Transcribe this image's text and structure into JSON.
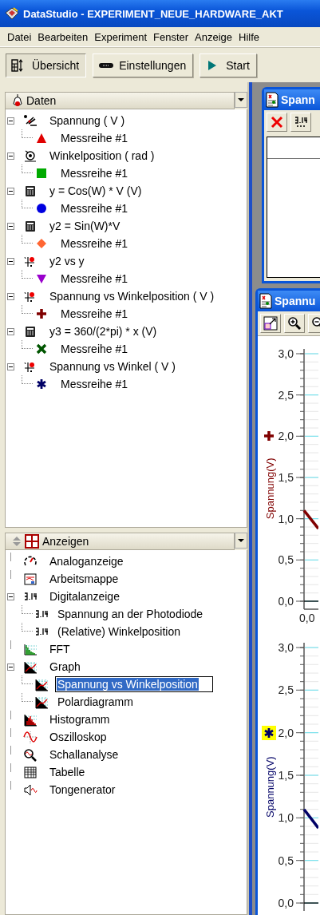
{
  "window": {
    "title": "DataStudio - EXPERIMENT_NEUE_HARDWARE_AKT"
  },
  "menu": [
    "Datei",
    "Bearbeiten",
    "Experiment",
    "Fenster",
    "Anzeige",
    "Hilfe"
  ],
  "toolbar": [
    {
      "label": "Übersicht",
      "kind": "overview",
      "pressed": true
    },
    {
      "label": "Einstellungen",
      "kind": "interface",
      "pressed": false
    },
    {
      "label": "Start",
      "kind": "play",
      "pressed": false
    }
  ],
  "data_panel": {
    "title": "Daten",
    "items": [
      {
        "label": "Spannung ( V )",
        "kind": "sensor",
        "expanded": true,
        "children": [
          {
            "label": "Messreihe #1",
            "kind": "triangle",
            "color": "#e00000"
          }
        ]
      },
      {
        "label": "Winkelposition ( rad )",
        "kind": "rotary",
        "expanded": true,
        "children": [
          {
            "label": "Messreihe #1",
            "kind": "square",
            "color": "#00aa00"
          }
        ]
      },
      {
        "label": "y = Cos(W) * V (V)",
        "kind": "calculator",
        "expanded": true,
        "children": [
          {
            "label": "Messreihe #1",
            "kind": "circle",
            "color": "#0000e0"
          }
        ]
      },
      {
        "label": "y2 = Sin(W)*V",
        "kind": "calculator",
        "expanded": true,
        "children": [
          {
            "label": "Messreihe #1",
            "kind": "diamond",
            "color": "#ff6633"
          }
        ]
      },
      {
        "label": "y2 vs y",
        "kind": "plot",
        "expanded": true,
        "children": [
          {
            "label": "Messreihe #1",
            "kind": "triangle-down",
            "color": "#9900cc"
          }
        ]
      },
      {
        "label": "Spannung vs Winkelposition ( V )",
        "kind": "plot",
        "expanded": true,
        "children": [
          {
            "label": "Messreihe #1",
            "kind": "plus",
            "color": "#800000"
          }
        ]
      },
      {
        "label": "y3 = 360/(2*pi) * x (V)",
        "kind": "calculator",
        "expanded": true,
        "children": [
          {
            "label": "Messreihe #1",
            "kind": "cross",
            "color": "#005500"
          }
        ]
      },
      {
        "label": "Spannung vs Winkel ( V )",
        "kind": "plot",
        "expanded": true,
        "children": [
          {
            "label": "Messreihe #1",
            "kind": "asterisk",
            "color": "#000066"
          }
        ]
      }
    ]
  },
  "displays_panel": {
    "title": "Anzeigen",
    "items": [
      {
        "label": "Analoganzeige",
        "kind": "gauge",
        "selected": false
      },
      {
        "label": "Arbeitsmappe",
        "kind": "workbook",
        "selected": false
      },
      {
        "label": "Digitalanzeige",
        "kind": "digits",
        "selected": false,
        "expanded": true,
        "children": [
          {
            "label": "Spannung an der Photodiode",
            "kind": "digits",
            "selected": false
          },
          {
            "label": "(Relative) Winkelposition",
            "kind": "digits",
            "selected": false
          }
        ]
      },
      {
        "label": "FFT",
        "kind": "fft",
        "selected": false
      },
      {
        "label": "Graph",
        "kind": "graph",
        "selected": false,
        "expanded": true,
        "children": [
          {
            "label": "Spannung vs Winkelposition",
            "kind": "graph",
            "selected": true
          },
          {
            "label": "Polardiagramm",
            "kind": "graph",
            "selected": false
          }
        ]
      },
      {
        "label": "Histogramm",
        "kind": "histogram",
        "selected": false
      },
      {
        "label": "Oszilloskop",
        "kind": "scope",
        "selected": false
      },
      {
        "label": "Schallanalyse",
        "kind": "sound",
        "selected": false
      },
      {
        "label": "Tabelle",
        "kind": "table",
        "selected": false
      },
      {
        "label": "Tongenerator",
        "kind": "tone",
        "selected": false
      }
    ]
  },
  "windows": [
    {
      "title": "Spann",
      "tools": [
        {
          "kind": "delete"
        },
        {
          "kind": "digits"
        }
      ]
    },
    {
      "title": "Spannu",
      "tools": [
        {
          "kind": "fit"
        },
        {
          "kind": "zoom-in"
        },
        {
          "kind": "zoom-out"
        }
      ],
      "plots": [
        {
          "color": "#800000",
          "legend_marker": {
            "kind": "plus",
            "highlighted": false
          },
          "y_axis_title": "Spannung(V)",
          "y_tick_labels": [
            "3,0",
            "2,5",
            "2,0",
            "1,5",
            "1,0",
            "0,5",
            "0,0"
          ],
          "x_tick_labels": [
            "0,0"
          ]
        },
        {
          "color": "#000066",
          "legend_marker": {
            "kind": "asterisk",
            "highlighted": true
          },
          "y_axis_title": "Spannung(V)",
          "y_tick_labels": [
            "3,0",
            "2,5",
            "2,0",
            "1,5",
            "1,0",
            "0,5",
            "0,0"
          ]
        }
      ]
    }
  ]
}
